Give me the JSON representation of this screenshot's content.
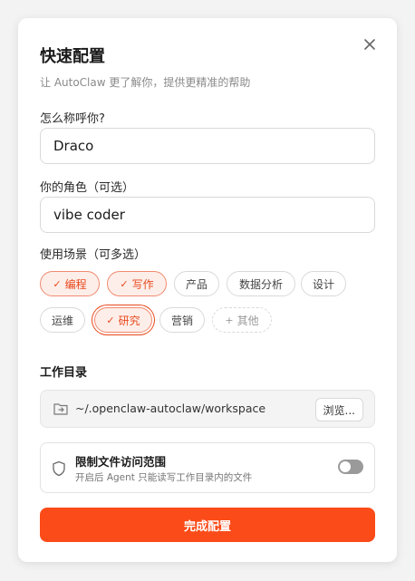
{
  "dialog": {
    "title": "快速配置",
    "subtitle": "让 AutoClaw 更了解你，提供更精准的帮助",
    "close_icon": "close-icon"
  },
  "name_field": {
    "label": "怎么称呼你?",
    "value": "Draco"
  },
  "role_field": {
    "label": "你的角色（可选）",
    "value": "vibe coder"
  },
  "scenarios": {
    "label": "使用场景（可多选）",
    "check_mark": "✓",
    "more_prefix": "+",
    "items": [
      {
        "label": "编程",
        "selected": true
      },
      {
        "label": "写作",
        "selected": true
      },
      {
        "label": "产品",
        "selected": false
      },
      {
        "label": "数据分析",
        "selected": false
      },
      {
        "label": "设计",
        "selected": false
      },
      {
        "label": "运维",
        "selected": false
      },
      {
        "label": "研究",
        "selected": true
      },
      {
        "label": "营销",
        "selected": false
      },
      {
        "label": "其他",
        "selected": false
      }
    ]
  },
  "workdir": {
    "title": "工作目录",
    "path": "~/.openclaw-autoclaw/workspace",
    "browse_label": "浏览...",
    "icon": "folder-icon"
  },
  "restrict": {
    "title": "限制文件访问范围",
    "description": "开启后 Agent 只能读写工作目录内的文件",
    "enabled": false,
    "icon": "shield-icon"
  },
  "submit_label": "完成配置",
  "colors": {
    "accent": "#fb4b18",
    "chip_selected_bg": "#fdeee9",
    "chip_selected_text": "#e8491d"
  }
}
